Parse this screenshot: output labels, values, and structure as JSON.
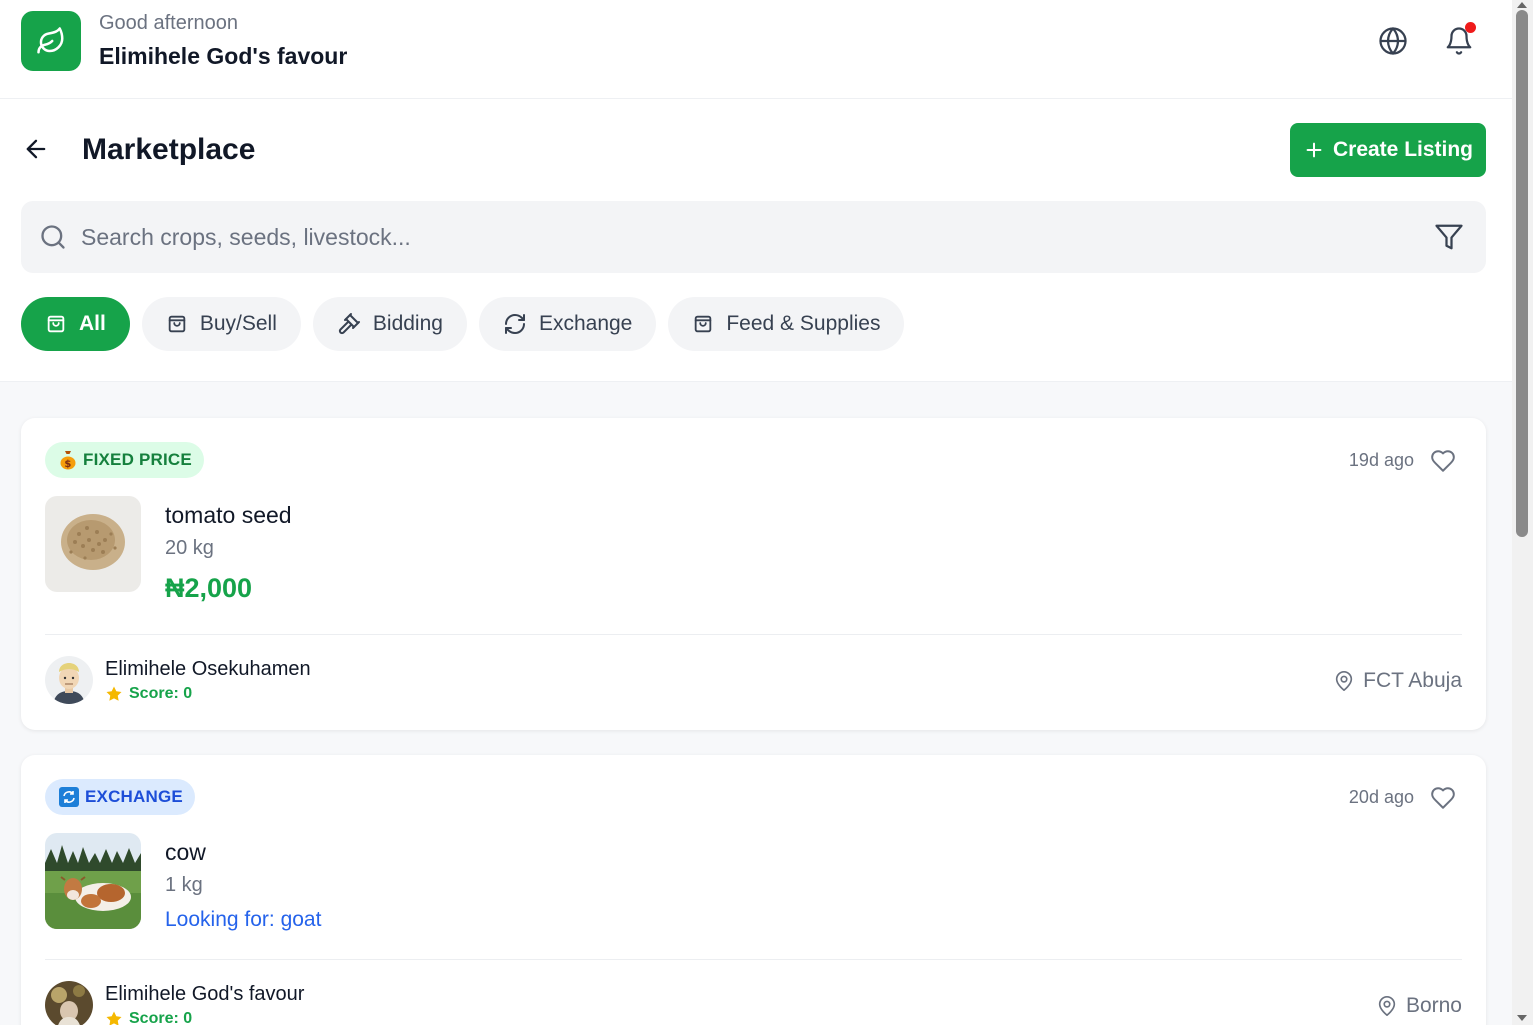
{
  "header": {
    "greeting": "Good afternoon",
    "user_name": "Elimihele God's favour",
    "brand_color": "#16a34a",
    "icons": [
      "leaf-icon",
      "globe-icon",
      "bell-icon"
    ]
  },
  "toolbar": {
    "title": "Marketplace",
    "create_label": "Create Listing"
  },
  "search": {
    "placeholder": "Search crops, seeds, livestock..."
  },
  "filters": [
    {
      "label": "All",
      "icon": "shopping-bag-icon",
      "active": true
    },
    {
      "label": "Buy/Sell",
      "icon": "shopping-bag-icon",
      "active": false
    },
    {
      "label": "Bidding",
      "icon": "gavel-icon",
      "active": false
    },
    {
      "label": "Exchange",
      "icon": "refresh-icon",
      "active": false
    },
    {
      "label": "Feed & Supplies",
      "icon": "shopping-bag-icon",
      "active": false
    }
  ],
  "listings": [
    {
      "badge": "FIXED PRICE",
      "badge_icon": "money-bag-icon",
      "age": "19d ago",
      "title": "tomato seed",
      "quantity": "20 kg",
      "price": "₦2,000",
      "seller": "Elimihele Osekuhamen",
      "score": "Score: 0",
      "location": "FCT Abuja"
    },
    {
      "badge": "EXCHANGE",
      "badge_icon": "exchange-icon",
      "age": "20d ago",
      "title": "cow",
      "quantity": "1 kg",
      "seeking": "Looking for: goat",
      "seller": "Elimihele God's favour",
      "score": "Score: 0",
      "location": "Borno"
    }
  ]
}
